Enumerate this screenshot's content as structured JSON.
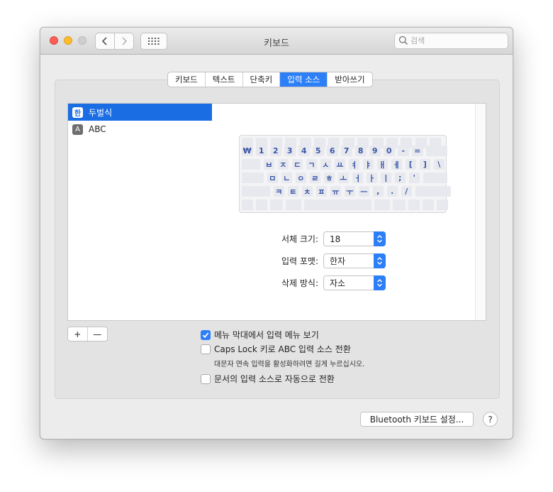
{
  "window": {
    "title": "키보드"
  },
  "search": {
    "placeholder": "검색"
  },
  "tabs": [
    {
      "label": "키보드"
    },
    {
      "label": "텍스트"
    },
    {
      "label": "단축키"
    },
    {
      "label": "입력 소스"
    },
    {
      "label": "받아쓰기"
    }
  ],
  "active_tab": "입력 소스",
  "input_sources": [
    {
      "icon_glyph": "한",
      "label": "두벌식",
      "selected": true
    },
    {
      "icon_glyph": "A",
      "label": "ABC",
      "selected": false
    }
  ],
  "keyboard": {
    "row1": [
      "₩",
      "1",
      "2",
      "3",
      "4",
      "5",
      "6",
      "7",
      "8",
      "9",
      "0",
      "-",
      "="
    ],
    "row2": [
      "ㅂ",
      "ㅈ",
      "ㄷ",
      "ㄱ",
      "ㅅ",
      "ㅛ",
      "ㅕ",
      "ㅑ",
      "ㅐ",
      "ㅔ",
      "[",
      "]",
      "\\"
    ],
    "row3": [
      "ㅁ",
      "ㄴ",
      "ㅇ",
      "ㄹ",
      "ㅎ",
      "ㅗ",
      "ㅓ",
      "ㅏ",
      "ㅣ",
      ";",
      "'"
    ],
    "row4": [
      "ㅋ",
      "ㅌ",
      "ㅊ",
      "ㅍ",
      "ㅠ",
      "ㅜ",
      "ㅡ",
      ",",
      ".",
      "/"
    ]
  },
  "settings": {
    "font_size": {
      "label": "서체 크기:",
      "value": "18"
    },
    "input_format": {
      "label": "입력 포맷:",
      "value": "한자"
    },
    "delete_mode": {
      "label": "삭제 방식:",
      "value": "자소"
    }
  },
  "list_controls": {
    "add": "+",
    "remove": "—"
  },
  "options": {
    "show_menu": {
      "label": "메뉴 막대에서 입력 메뉴 보기",
      "checked": true
    },
    "caps_lock": {
      "label": "Caps Lock 키로 ABC 입력 소스 전환",
      "checked": false,
      "hint": "대문자 연속 입력을 활성화하려면 길게 누르십시오."
    },
    "auto_switch": {
      "label": "문서의 입력 소스로 자동으로 전환",
      "checked": false
    }
  },
  "buttons": {
    "bluetooth": "Bluetooth 키보드 설정...",
    "help": "?"
  },
  "colors": {
    "accent": "#2d7ff7",
    "selection": "#1a6de3",
    "key_text": "#3b58a8"
  }
}
